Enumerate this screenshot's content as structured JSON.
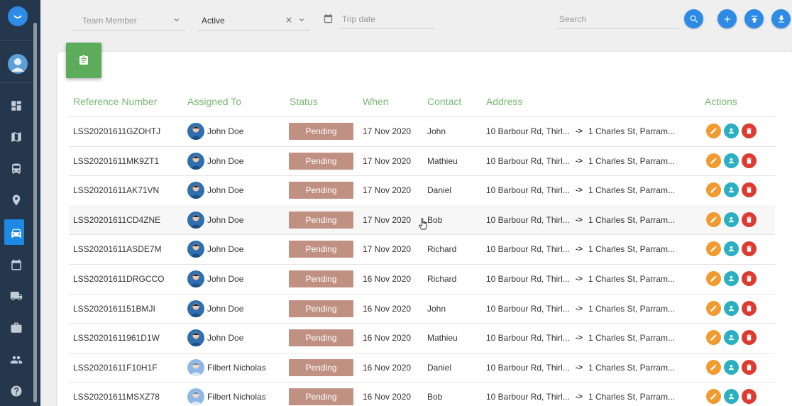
{
  "filters": {
    "team_member_placeholder": "Team Member",
    "status_value": "Active",
    "trip_date_placeholder": "Trip date",
    "search_placeholder": "Search"
  },
  "table": {
    "headers": [
      "Reference Number",
      "Assigned To",
      "Status",
      "When",
      "Contact",
      "Address",
      "Actions"
    ],
    "rows": [
      {
        "ref": "LSS20201611GZOHTJ",
        "assigned": "John Doe",
        "status": "Pending",
        "when": "17 Nov 2020",
        "contact": "John",
        "from": "10 Barbour Rd, Thirl...",
        "arrow": "->",
        "to": "1 Charles St, Parram..."
      },
      {
        "ref": "LSS20201611MK9ZT1",
        "assigned": "John Doe",
        "status": "Pending",
        "when": "17 Nov 2020",
        "contact": "Mathieu",
        "from": "10 Barbour Rd, Thirl...",
        "arrow": "->",
        "to": "1 Charles St, Parram..."
      },
      {
        "ref": "LSS20201611AK71VN",
        "assigned": "John Doe",
        "status": "Pending",
        "when": "17 Nov 2020",
        "contact": "Daniel",
        "from": "10 Barbour Rd, Thirl...",
        "arrow": "->",
        "to": "1 Charles St, Parram..."
      },
      {
        "ref": "LSS20201611CD4ZNE",
        "assigned": "John Doe",
        "status": "Pending",
        "when": "17 Nov 2020",
        "contact": "Bob",
        "from": "10 Barbour Rd, Thirl...",
        "arrow": "->",
        "to": "1 Charles St, Parram..."
      },
      {
        "ref": "LSS20201611ASDE7M",
        "assigned": "John Doe",
        "status": "Pending",
        "when": "17 Nov 2020",
        "contact": "Richard",
        "from": "10 Barbour Rd, Thirl...",
        "arrow": "->",
        "to": "1 Charles St, Parram..."
      },
      {
        "ref": "LSS20201611DRGCCO",
        "assigned": "John Doe",
        "status": "Pending",
        "when": "16 Nov 2020",
        "contact": "Richard",
        "from": "10 Barbour Rd, Thirl...",
        "arrow": "->",
        "to": "1 Charles St, Parram..."
      },
      {
        "ref": "LSS2020161151BMJI",
        "assigned": "John Doe",
        "status": "Pending",
        "when": "16 Nov 2020",
        "contact": "John",
        "from": "10 Barbour Rd, Thirl...",
        "arrow": "->",
        "to": "1 Charles St, Parram..."
      },
      {
        "ref": "LSS20201611961D1W",
        "assigned": "John Doe",
        "status": "Pending",
        "when": "16 Nov 2020",
        "contact": "Mathieu",
        "from": "10 Barbour Rd, Thirl...",
        "arrow": "->",
        "to": "1 Charles St, Parram..."
      },
      {
        "ref": "LSS20201611F10H1F",
        "assigned": "Filbert Nicholas",
        "status": "Pending",
        "when": "16 Nov 2020",
        "contact": "Daniel",
        "from": "10 Barbour Rd, Thirl...",
        "arrow": "->",
        "to": "1 Charles St, Parram..."
      },
      {
        "ref": "LSS20201611MSXZ78",
        "assigned": "Filbert Nicholas",
        "status": "Pending",
        "when": "16 Nov 2020",
        "contact": "Bob",
        "from": "10 Barbour Rd, Thirl...",
        "arrow": "->",
        "to": "1 Charles St, Parram..."
      }
    ]
  },
  "sidebar": {
    "items": [
      "dashboard-icon",
      "map-icon",
      "bus-icon",
      "location-pin-icon",
      "car-icon",
      "calendar-icon",
      "truck-icon",
      "briefcase-icon",
      "people-icon",
      "help-icon"
    ],
    "active": "car-icon"
  },
  "colors": {
    "sidebar": "#25374d",
    "accent_blue": "#2e8be5",
    "header_green": "#77b873",
    "pending_badge": "#c09183",
    "edit": "#f19a2f",
    "view": "#2bb0c3",
    "delete": "#dd3b2f"
  }
}
